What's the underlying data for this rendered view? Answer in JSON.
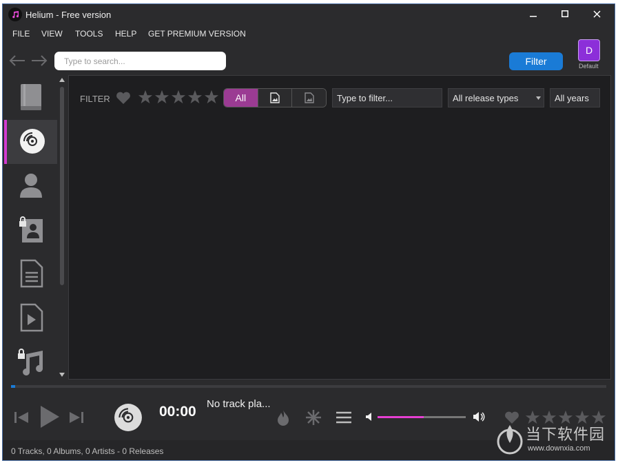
{
  "window": {
    "title": "Helium - Free version"
  },
  "menu": [
    "FILE",
    "VIEW",
    "TOOLS",
    "HELP",
    "GET PREMIUM VERSION"
  ],
  "search": {
    "placeholder": "Type to search..."
  },
  "filter_button": "Filter",
  "profile": {
    "initial": "D",
    "label": "Default"
  },
  "sidebar": {
    "items": [
      {
        "icon": "library-book-icon"
      },
      {
        "icon": "albums-disc-icon",
        "active": true
      },
      {
        "icon": "artist-person-icon"
      },
      {
        "icon": "locked-contacts-icon"
      },
      {
        "icon": "document-list-icon"
      },
      {
        "icon": "video-file-icon"
      },
      {
        "icon": "locked-music-icon"
      }
    ]
  },
  "filter_bar": {
    "label": "FILTER",
    "rating_stars": 5,
    "segments": [
      "All",
      "with-cover-icon",
      "without-cover-icon"
    ],
    "text_filter": "Type to filter...",
    "release_type": "All release types",
    "years": "All years"
  },
  "player": {
    "time": "00:00",
    "track": "No track pla...",
    "volume_percent": 52,
    "progress_percent": 0.7
  },
  "status": "0 Tracks, 0 Albums, 0 Artists - 0 Releases",
  "watermark": {
    "text": "当下软件园",
    "url": "www.downxia.com"
  },
  "colors": {
    "accent": "#9b3b93",
    "sidebar_active": "#d33ad0",
    "primary": "#1a7bd6",
    "volume": "#e63fd3"
  }
}
